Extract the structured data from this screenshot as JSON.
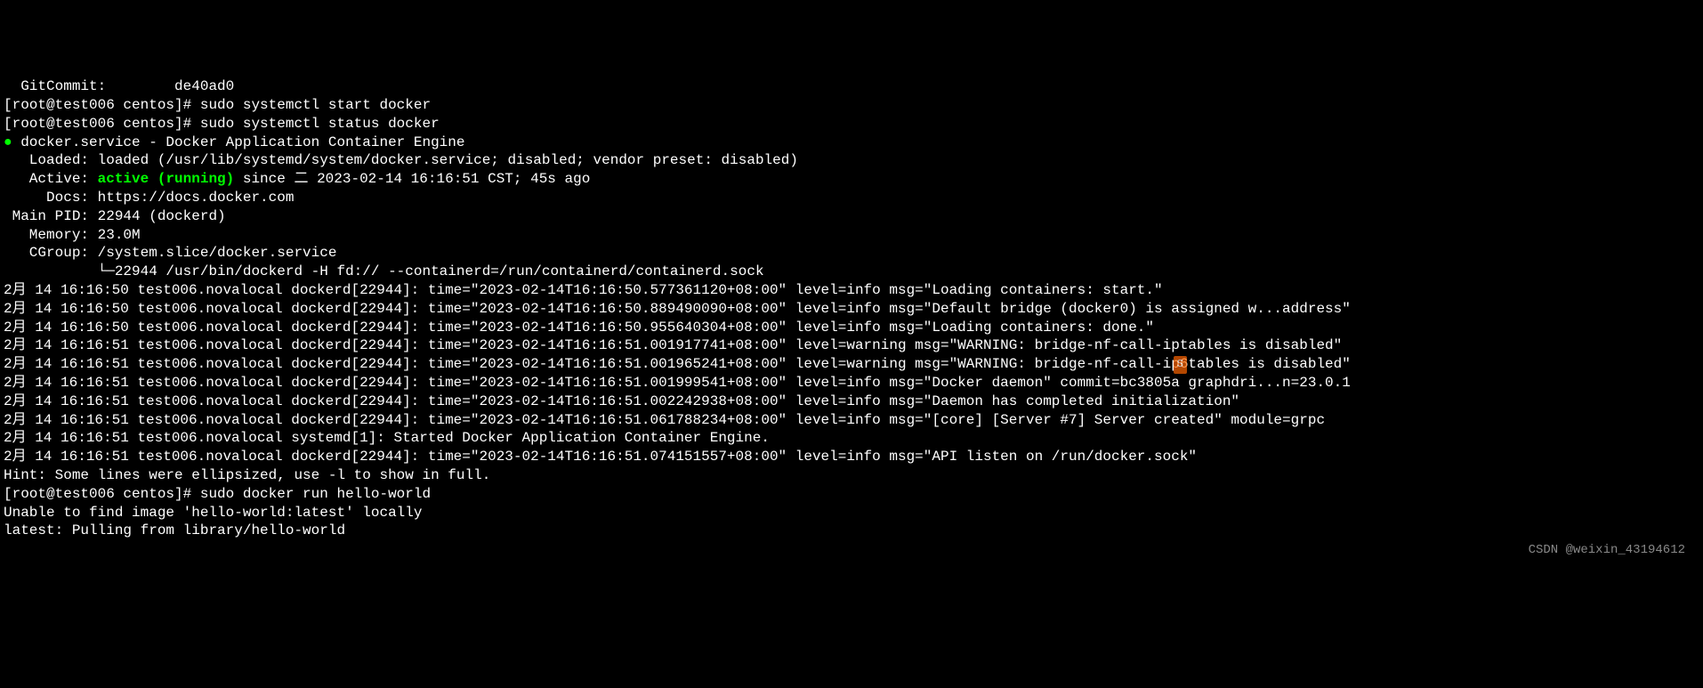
{
  "lines": {
    "l0": "  GitCommit:        de40ad0",
    "l1": "[root@test006 centos]# sudo systemctl start docker",
    "l2": "[root@test006 centos]# sudo systemctl status docker",
    "l3_prefix": "● ",
    "l3": "docker.service - Docker Application Container Engine",
    "l4": "   Loaded: loaded (/usr/lib/systemd/system/docker.service; disabled; vendor preset: disabled)",
    "l5_prefix": "   Active: ",
    "l5_active": "active (running)",
    "l5_suffix": " since 二 2023-02-14 16:16:51 CST; 45s ago",
    "l6": "     Docs: https://docs.docker.com",
    "l7": " Main PID: 22944 (dockerd)",
    "l8": "   Memory: 23.0M",
    "l9": "   CGroup: /system.slice/docker.service",
    "l10": "           └─22944 /usr/bin/dockerd -H fd:// --containerd=/run/containerd/containerd.sock",
    "l11": "",
    "l12": "2月 14 16:16:50 test006.novalocal dockerd[22944]: time=\"2023-02-14T16:16:50.577361120+08:00\" level=info msg=\"Loading containers: start.\"",
    "l13": "2月 14 16:16:50 test006.novalocal dockerd[22944]: time=\"2023-02-14T16:16:50.889490090+08:00\" level=info msg=\"Default bridge (docker0) is assigned w...address\"",
    "l14": "2月 14 16:16:50 test006.novalocal dockerd[22944]: time=\"2023-02-14T16:16:50.955640304+08:00\" level=info msg=\"Loading containers: done.\"",
    "l15": "2月 14 16:16:51 test006.novalocal dockerd[22944]: time=\"2023-02-14T16:16:51.001917741+08:00\" level=warning msg=\"WARNING: bridge-nf-call-iptables is disabled\"",
    "l16": "2月 14 16:16:51 test006.novalocal dockerd[22944]: time=\"2023-02-14T16:16:51.001965241+08:00\" level=warning msg=\"WARNING: bridge-nf-call-ip6tables is disabled\"",
    "l17": "2月 14 16:16:51 test006.novalocal dockerd[22944]: time=\"2023-02-14T16:16:51.001999541+08:00\" level=info msg=\"Docker daemon\" commit=bc3805a graphdri...n=23.0.1",
    "l18": "2月 14 16:16:51 test006.novalocal dockerd[22944]: time=\"2023-02-14T16:16:51.002242938+08:00\" level=info msg=\"Daemon has completed initialization\"",
    "l19": "2月 14 16:16:51 test006.novalocal dockerd[22944]: time=\"2023-02-14T16:16:51.061788234+08:00\" level=info msg=\"[core] [Server #7] Server created\" module=grpc",
    "l20": "2月 14 16:16:51 test006.novalocal systemd[1]: Started Docker Application Container Engine.",
    "l21": "2月 14 16:16:51 test006.novalocal dockerd[22944]: time=\"2023-02-14T16:16:51.074151557+08:00\" level=info msg=\"API listen on /run/docker.sock\"",
    "l22": "Hint: Some lines were ellipsized, use -l to show in full.",
    "l23": "[root@test006 centos]# sudo docker run hello-world",
    "l24": "Unable to find image 'hello-world:latest' locally",
    "l25": "latest: Pulling from library/hello-world"
  },
  "watermark": "CSDN @weixin_43194612",
  "logo": "S"
}
